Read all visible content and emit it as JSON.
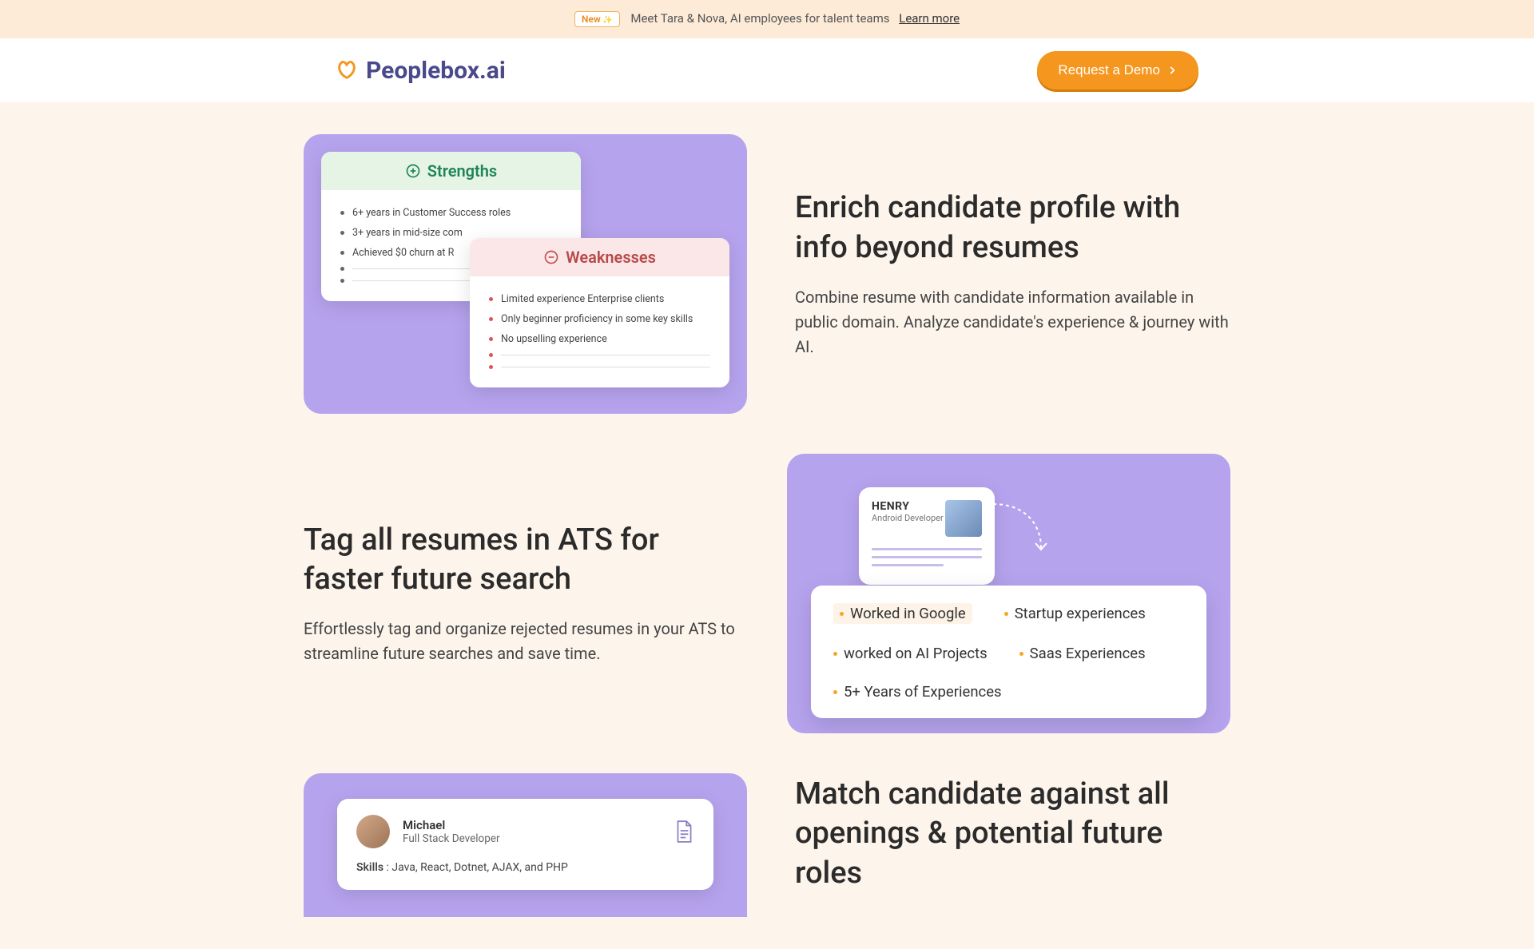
{
  "announcement": {
    "badge": "New",
    "text": "Meet Tara & Nova, AI employees for talent teams",
    "link": "Learn more"
  },
  "nav": {
    "logo": "Peoplebox.ai",
    "cta": "Request a Demo"
  },
  "section1": {
    "title": "Enrich candidate profile with info beyond resumes",
    "body": "Combine resume with candidate information available in public domain. Analyze candidate's experience & journey with AI.",
    "strengths_label": "Strengths",
    "strengths": [
      "6+ years in Customer Success roles",
      "3+ years in mid-size com",
      "Achieved $0 churn at R"
    ],
    "weak_label": "Weaknesses",
    "weak": [
      "Limited experience Enterprise clients",
      "Only beginner proficiency in some key skills",
      "No upselling experience"
    ]
  },
  "section2": {
    "title": "Tag all resumes in ATS for faster future search",
    "body": "Effortlessly tag and organize rejected resumes in your ATS to streamline future searches and save time.",
    "profile_name": "HENRY",
    "profile_role": "Android Developer",
    "tags": [
      "Worked in Google",
      "Startup experiences",
      "worked on AI Projects",
      "Saas Experiences",
      "5+ Years of Experiences"
    ]
  },
  "section3": {
    "title": "Match candidate against all openings & potential future roles",
    "candidate_name": "Michael",
    "candidate_role": "Full Stack Developer",
    "skills_label": "Skills",
    "skills_value": " : Java, React, Dotnet, AJAX, and PHP"
  }
}
